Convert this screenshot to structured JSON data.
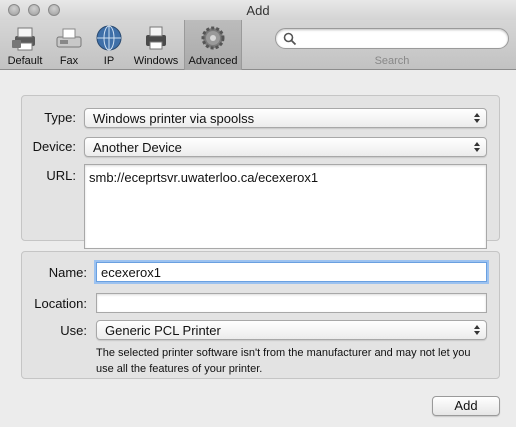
{
  "window": {
    "title": "Add"
  },
  "toolbar": {
    "items": [
      {
        "label": "Default",
        "icon": "default-printers-icon",
        "selected": false
      },
      {
        "label": "Fax",
        "icon": "fax-icon",
        "selected": false
      },
      {
        "label": "IP",
        "icon": "globe-icon",
        "selected": false
      },
      {
        "label": "Windows",
        "icon": "windows-printer-icon",
        "selected": false
      },
      {
        "label": "Advanced",
        "icon": "gear-icon",
        "selected": true
      }
    ],
    "search": {
      "placeholder": "",
      "caption": "Search"
    }
  },
  "connection": {
    "type_label": "Type:",
    "type_value": "Windows printer via spoolss",
    "device_label": "Device:",
    "device_value": "Another Device",
    "url_label": "URL:",
    "url_value": "smb://eceprtsvr.uwaterloo.ca/ecexerox1"
  },
  "printer": {
    "name_label": "Name:",
    "name_value": "ecexerox1",
    "location_label": "Location:",
    "location_value": "",
    "use_label": "Use:",
    "use_value": "Generic PCL Printer",
    "note": "The selected printer software isn't from the manufacturer and may not let you use all the features of your printer."
  },
  "footer": {
    "add_label": "Add"
  },
  "colors": {
    "focus_ring": "#9cc2f0",
    "window_bg": "#ececec"
  }
}
